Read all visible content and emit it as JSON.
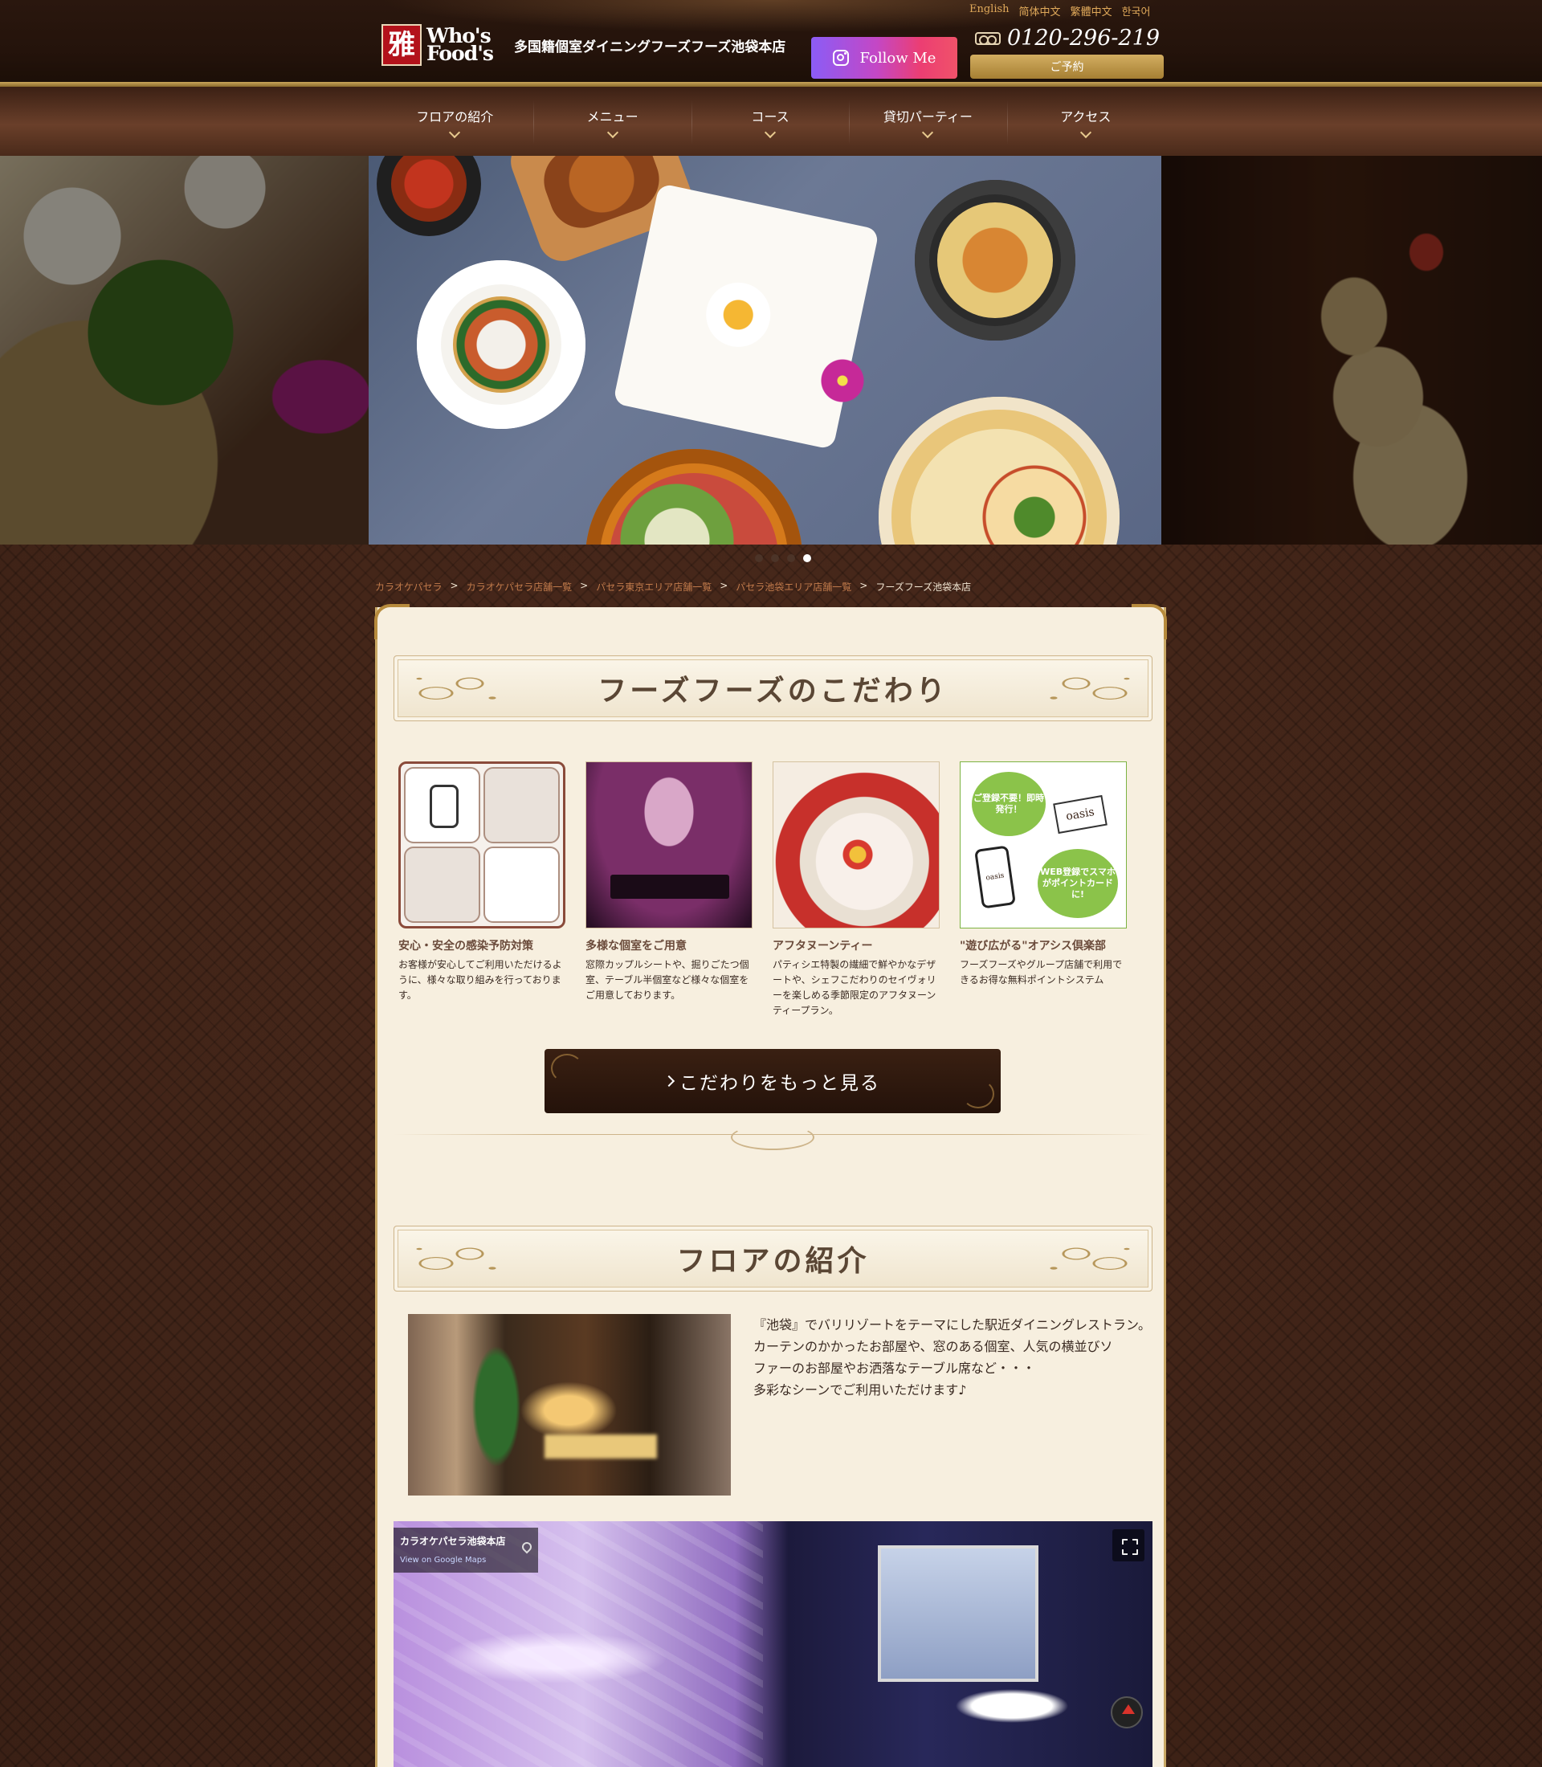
{
  "header": {
    "logo_kanji": "雅",
    "logo_line1": "Who's",
    "logo_line2": "Food's",
    "tagline": "多国籍個室ダイニングフーズフーズ池袋本店",
    "languages": [
      "English",
      "简体中文",
      "繁體中文",
      "한국어"
    ],
    "instagram_label": "Follow Me",
    "phone": "0120-296-219",
    "reserve_label": "ご予約"
  },
  "nav": {
    "items": [
      {
        "label": "フロアの紹介"
      },
      {
        "label": "メニュー"
      },
      {
        "label": "コース"
      },
      {
        "label": "貸切パーティー"
      },
      {
        "label": "アクセス"
      }
    ]
  },
  "hero": {
    "slide_count": 4,
    "active_slide": 4
  },
  "breadcrumb": {
    "items": [
      "カラオケパセラ",
      "カラオケパセラ店舗一覧",
      "パセラ東京エリア店舗一覧",
      "パセラ池袋エリア店舗一覧"
    ],
    "separator": ">",
    "current": "フーズフーズ池袋本店"
  },
  "kodawari": {
    "title": "フーズフーズのこだわり",
    "features": [
      {
        "title": "安心・安全の感染予防対策",
        "text": "お客様が安心してご利用いただけるように、様々な取り組みを行っております。"
      },
      {
        "title": "多様な個室をご用意",
        "text": "窓際カップルシートや、掘りごたつ個室、テーブル半個室など様々な個室をご用意しております。"
      },
      {
        "title": "アフタヌーンティー",
        "text": "パティシエ特製の繊細で鮮やかなデザートや、シェフこだわりのセイヴォリーを楽しめる季節限定のアフタヌーンティープラン。"
      },
      {
        "title": "\"遊び広がる\"オアシス倶楽部",
        "text": "フーズフーズやグループ店舗で利用できるお得な無料ポイントシステム"
      }
    ],
    "oasis_bubble1": "ご登録不要！即時発行！",
    "oasis_bubble2": "WEB登録でスマホがポイントカードに!",
    "oasis_card": "oasis",
    "more_label": "こだわりをもっと見る"
  },
  "floor": {
    "title": "フロアの紹介",
    "lines": [
      "『池袋』でバリリゾートをテーマにした駅近ダイニングレストラン。",
      "カーテンのかかったお部屋や、窓のある個室、人気の横並びソ",
      "ファーのお部屋やお洒落なテーブル席など・・・",
      "多彩なシーンでご利用いただけます♪"
    ]
  },
  "streetview": {
    "place_name": "カラオケパセラ池袋本店",
    "link_label": "View on Google Maps"
  },
  "colors": {
    "gold": "#c9a55a",
    "dark_brown": "#24130b",
    "panel_bg": "#f7efdf",
    "link_orange": "#e0a95a"
  }
}
